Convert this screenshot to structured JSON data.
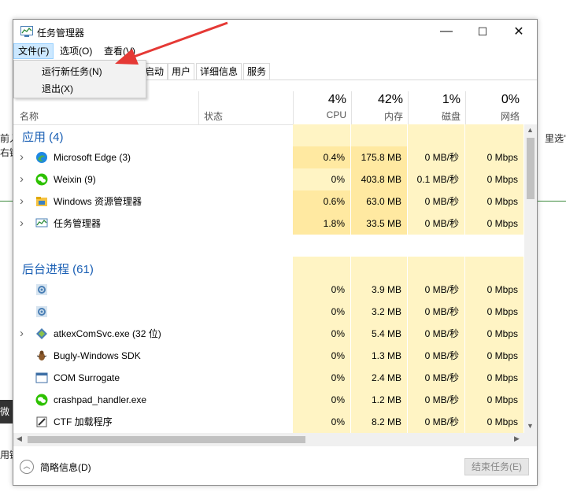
{
  "background": {
    "left_snippets": [
      "前入",
      "右键",
      "用键"
    ],
    "right_snippet": "里选\"运",
    "left_badge": "微信"
  },
  "window": {
    "title": "任务管理器",
    "controls": {
      "minimize": "—",
      "maximize": "☐",
      "close": "✕"
    }
  },
  "menubar": {
    "items": [
      {
        "label": "文件(F)"
      },
      {
        "label": "选项(O)"
      },
      {
        "label": "查看(V)"
      }
    ],
    "file_menu": {
      "items": [
        {
          "label": "运行新任务(N)"
        },
        {
          "label": "退出(X)"
        }
      ]
    }
  },
  "tabs": [
    {
      "label": "启动"
    },
    {
      "label": "用户"
    },
    {
      "label": "详细信息"
    },
    {
      "label": "服务"
    }
  ],
  "columns": {
    "name": "名称",
    "status": "状态",
    "cpu": {
      "pct": "4%",
      "label": "CPU"
    },
    "memory": {
      "pct": "42%",
      "label": "内存"
    },
    "disk": {
      "pct": "1%",
      "label": "磁盘"
    },
    "network": {
      "pct": "0%",
      "label": "网络"
    }
  },
  "groups": {
    "apps": "应用 (4)",
    "background": "后台进程 (61)"
  },
  "processes": [
    {
      "name": "Microsoft Edge (3)",
      "icon": "edge-icon",
      "cpu": "0.4%",
      "mem": "175.8 MB",
      "disk": "0 MB/秒",
      "net": "0 Mbps"
    },
    {
      "name": "Weixin (9)",
      "icon": "wechat-icon",
      "cpu": "0%",
      "mem": "403.8 MB",
      "disk": "0.1 MB/秒",
      "net": "0 Mbps"
    },
    {
      "name": "Windows 资源管理器",
      "icon": "folder-icon",
      "cpu": "0.6%",
      "mem": "63.0 MB",
      "disk": "0 MB/秒",
      "net": "0 Mbps"
    },
    {
      "name": "任务管理器",
      "icon": "task-manager-icon",
      "cpu": "1.8%",
      "mem": "33.5 MB",
      "disk": "0 MB/秒",
      "net": "0 Mbps"
    },
    {
      "name": "",
      "icon": "gear-icon",
      "cpu": "0%",
      "mem": "3.9 MB",
      "disk": "0 MB/秒",
      "net": "0 Mbps"
    },
    {
      "name": "",
      "icon": "gear-icon",
      "cpu": "0%",
      "mem": "3.2 MB",
      "disk": "0 MB/秒",
      "net": "0 Mbps"
    },
    {
      "name": "atkexComSvc.exe (32 位)",
      "icon": "diamond-icon",
      "cpu": "0%",
      "mem": "5.4 MB",
      "disk": "0 MB/秒",
      "net": "0 Mbps"
    },
    {
      "name": "Bugly-Windows SDK",
      "icon": "bug-icon",
      "cpu": "0%",
      "mem": "1.3 MB",
      "disk": "0 MB/秒",
      "net": "0 Mbps"
    },
    {
      "name": "COM Surrogate",
      "icon": "window-icon",
      "cpu": "0%",
      "mem": "2.4 MB",
      "disk": "0 MB/秒",
      "net": "0 Mbps"
    },
    {
      "name": "crashpad_handler.exe",
      "icon": "wechat-icon",
      "cpu": "0%",
      "mem": "1.2 MB",
      "disk": "0 MB/秒",
      "net": "0 Mbps"
    },
    {
      "name": "CTF 加载程序",
      "icon": "pen-icon",
      "cpu": "0%",
      "mem": "8.2 MB",
      "disk": "0 MB/秒",
      "net": "0 Mbps"
    }
  ],
  "footer": {
    "brief": "简略信息(D)",
    "end_task": "结束任务(E)"
  },
  "colors": {
    "accent_group": "#1a5fb4",
    "heat_light": "#fff4c4",
    "heat_mid": "#ffe9a1",
    "annotation_arrow": "#e53935"
  }
}
